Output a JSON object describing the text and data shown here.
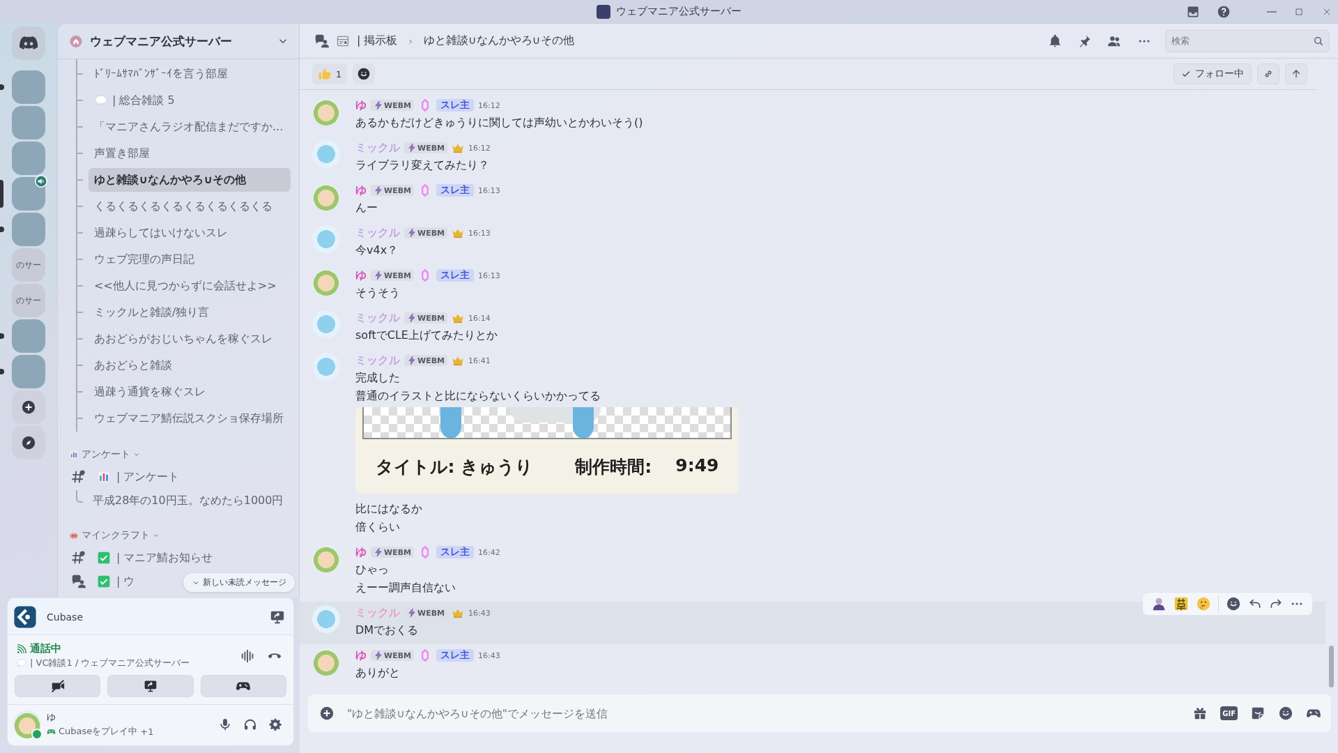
{
  "window": {
    "title": "ウェブマニア公式サーバー"
  },
  "rail": {
    "servers": [
      {
        "kind": "image",
        "unread": true,
        "selected": false,
        "voice": false
      },
      {
        "kind": "image",
        "unread": false,
        "selected": false,
        "voice": false
      },
      {
        "kind": "image",
        "unread": false,
        "selected": false,
        "voice": false
      },
      {
        "kind": "image",
        "unread": false,
        "selected": true,
        "voice": true
      },
      {
        "kind": "image",
        "unread": true,
        "selected": false,
        "voice": false
      },
      {
        "kind": "text",
        "label": "のサー",
        "unread": false,
        "selected": false,
        "voice": false
      },
      {
        "kind": "text",
        "label": "のサー",
        "unread": false,
        "selected": false,
        "voice": false
      },
      {
        "kind": "image",
        "unread": true,
        "selected": false,
        "voice": false
      },
      {
        "kind": "image",
        "unread": true,
        "selected": false,
        "voice": false
      }
    ]
  },
  "server": {
    "name": "ウェブマニア公式サーバー",
    "threads": [
      {
        "name": "ﾄﾞﾘｰﾑｻﾏﾊﾞﾝｻﾞｰｲを言う部屋",
        "kind": "plain",
        "selected": false
      },
      {
        "name": "| 総合雑談 5",
        "kind": "bubble",
        "selected": false
      },
      {
        "name": "「マニアさんラジオ配信まだですか...",
        "kind": "plain",
        "selected": false
      },
      {
        "name": "声置き部屋",
        "kind": "plain",
        "selected": false
      },
      {
        "name": "ゆと雑談∪なんかやろ∪その他",
        "kind": "plain",
        "selected": true
      },
      {
        "name": "くるくるくるくるくるくるくるくる",
        "kind": "plain",
        "selected": false
      },
      {
        "name": "過疎らしてはいけないスレ",
        "kind": "plain",
        "selected": false
      },
      {
        "name": "ウェブ完理の声日記",
        "kind": "plain",
        "selected": false
      },
      {
        "name": "<<他人に見つからずに会話せよ>>",
        "kind": "plain",
        "selected": false
      },
      {
        "name": "ミックルと雑談/独り言",
        "kind": "plain",
        "selected": false
      },
      {
        "name": "あおどらがおじいちゃんを稼ぐスレ",
        "kind": "plain",
        "selected": false
      },
      {
        "name": "あおどらと雑談",
        "kind": "plain",
        "selected": false
      },
      {
        "name": "過疎う通貨を稼ぐスレ",
        "kind": "plain",
        "selected": false
      },
      {
        "name": "ウェブマニア鯖伝説スクショ保存場所",
        "kind": "plain",
        "selected": false
      }
    ],
    "categories": [
      {
        "name": "アンケート",
        "channels": [
          {
            "name": "| アンケート",
            "kind": "text",
            "children": [
              {
                "name": "平成28年の10円玉。なめたら1000円"
              }
            ]
          }
        ]
      },
      {
        "name": "マインクラフト",
        "channels": [
          {
            "name": "| マニア鯖お知らせ",
            "kind": "text"
          },
          {
            "name": "| ウ",
            "kind": "forum"
          }
        ]
      }
    ],
    "unread_pill": "新しい未読メッセージ"
  },
  "activity": {
    "app": "Cubase"
  },
  "voice": {
    "status": "通話中",
    "channel": "| VC雑談1 / ウェブマニア公式サーバー"
  },
  "user": {
    "name": "ゆ",
    "activity": "Cubaseをプレイ中",
    "extra": "+1"
  },
  "header": {
    "parent": "| 掲示板",
    "separator": "›",
    "thread": "ゆと雑談∪なんかやろ∪その他",
    "search": {
      "placeholder": "検索"
    }
  },
  "thread_bar": {
    "reactions": [
      {
        "count": "1"
      }
    ],
    "follow": "フォロー中"
  },
  "messages": [
    {
      "kind": "yu",
      "author": "ゆ",
      "color": "#d94fb5",
      "tag": "WEBM",
      "role": "スレ主",
      "time": "16:12",
      "lines": [
        "あるかもだけどきゅうりに関しては声幼いとかわいそう()"
      ],
      "hovered": false
    },
    {
      "kind": "mikkuru",
      "author": "ミックル",
      "color": "#c5a6dc",
      "tag": "WEBM",
      "time": "16:12",
      "lines": [
        "ライブラリ変えてみたり？"
      ],
      "hovered": false
    },
    {
      "kind": "yu",
      "author": "ゆ",
      "color": "#d94fb5",
      "tag": "WEBM",
      "role": "スレ主",
      "time": "16:13",
      "lines": [
        "んー"
      ],
      "hovered": false
    },
    {
      "kind": "mikkuru",
      "author": "ミックル",
      "color": "#c5a6dc",
      "tag": "WEBM",
      "time": "16:13",
      "lines": [
        "今v4x？"
      ],
      "hovered": false
    },
    {
      "kind": "yu",
      "author": "ゆ",
      "color": "#d94fb5",
      "tag": "WEBM",
      "role": "スレ主",
      "time": "16:13",
      "lines": [
        "そうそう"
      ],
      "hovered": false
    },
    {
      "kind": "mikkuru",
      "author": "ミックル",
      "color": "#c5a6dc",
      "tag": "WEBM",
      "time": "16:14",
      "lines": [
        "softでCLE上げてみたりとか"
      ],
      "hovered": false
    },
    {
      "kind": "mikkuru",
      "author": "ミックル",
      "color": "#c5a6dc",
      "tag": "WEBM",
      "time": "16:41",
      "lines": [
        "完成した",
        "普通のイラストと比にならないくらいかかってる"
      ],
      "attachment": {
        "title": "タイトル: きゅうり",
        "label": "制作時間:",
        "duration": "9:49"
      },
      "after_lines": [
        "比にはなるか",
        "倍くらい"
      ],
      "hovered": false
    },
    {
      "kind": "yu",
      "author": "ゆ",
      "color": "#d94fb5",
      "tag": "WEBM",
      "role": "スレ主",
      "time": "16:42",
      "lines": [
        "ひゃっ",
        "えーー調声自信ない"
      ],
      "hovered": false
    },
    {
      "kind": "mikkuru",
      "author": "ミックル",
      "color": "#e8a0c8",
      "tag": "WEBM",
      "time": "16:43",
      "lines": [
        "DMでおくる"
      ],
      "hovered": true
    },
    {
      "kind": "yu",
      "author": "ゆ",
      "color": "#d94fb5",
      "tag": "WEBM",
      "role": "スレ主",
      "time": "16:43",
      "lines": [
        "ありがと"
      ],
      "hovered": false
    }
  ],
  "composer": {
    "placeholder": "\"ゆと雑談∪なんかやろ∪その他\"でメッセージを送信",
    "gif_label": "GIF"
  }
}
